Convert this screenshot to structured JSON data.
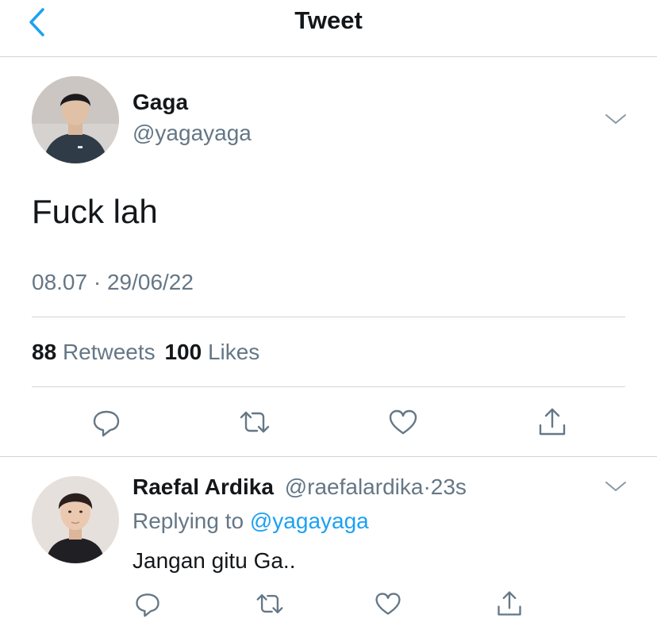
{
  "header": {
    "title": "Tweet",
    "back_icon": "chevron-left-icon",
    "accent": "#1da1f2"
  },
  "tweet": {
    "display_name": "Gaga",
    "handle": "@yagayaga",
    "text": "Fuck lah",
    "timestamp": "08.07 · 29/06/22",
    "retweets_count": "88",
    "retweets_label": "Retweets",
    "likes_count": "100",
    "likes_label": "Likes",
    "menu_icon": "chevron-down-icon",
    "actions": [
      "reply-icon",
      "retweet-icon",
      "like-icon",
      "share-icon"
    ]
  },
  "reply": {
    "display_name": "Raefal Ardika",
    "handle": "@raefalardika",
    "separator": "·",
    "time_ago": "23s",
    "replying_prefix": "Replying to",
    "replying_handle": "@yagayaga",
    "text": "Jangan gitu Ga..",
    "menu_icon": "chevron-down-icon",
    "actions": [
      "reply-icon",
      "retweet-icon",
      "like-icon",
      "share-icon"
    ]
  },
  "colors": {
    "text": "#14171a",
    "muted": "#657786",
    "link": "#1da1f2",
    "divider": "#cfd4d9"
  }
}
